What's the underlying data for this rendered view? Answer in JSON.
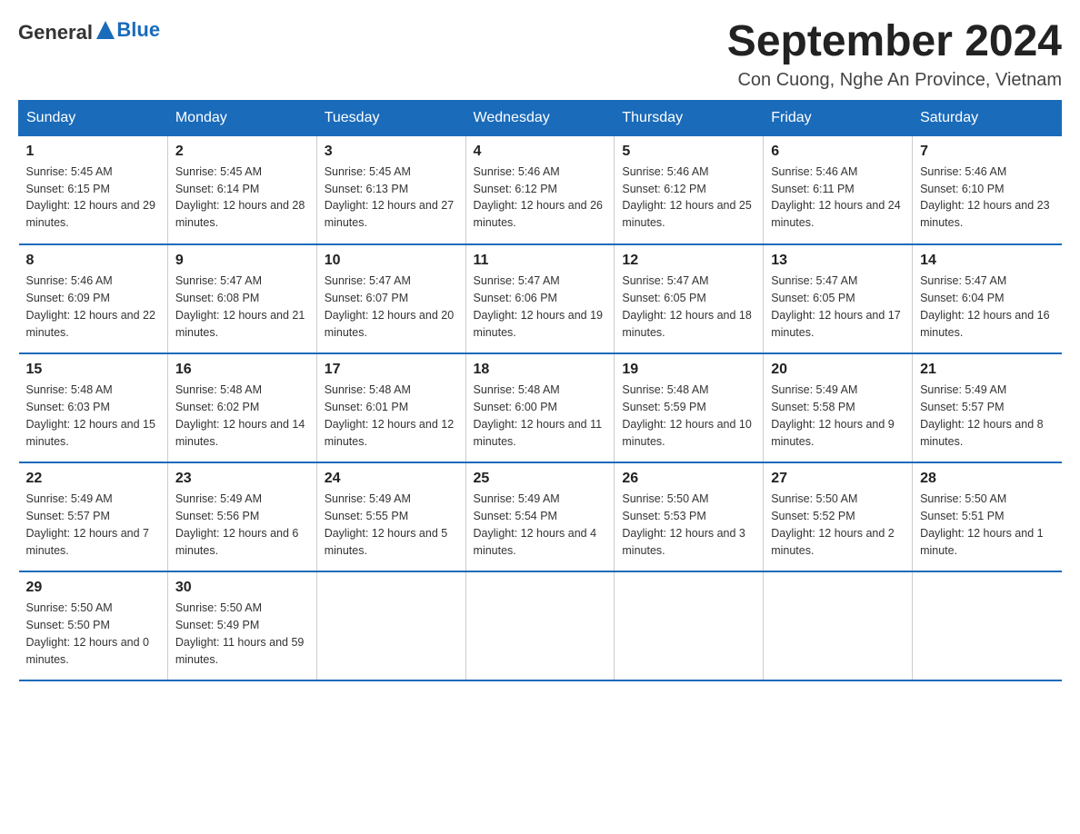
{
  "header": {
    "logo": {
      "general": "General",
      "blue": "Blue"
    },
    "title": "September 2024",
    "subtitle": "Con Cuong, Nghe An Province, Vietnam"
  },
  "columns": [
    "Sunday",
    "Monday",
    "Tuesday",
    "Wednesday",
    "Thursday",
    "Friday",
    "Saturday"
  ],
  "weeks": [
    [
      {
        "day": "1",
        "sunrise": "5:45 AM",
        "sunset": "6:15 PM",
        "daylight": "12 hours and 29 minutes."
      },
      {
        "day": "2",
        "sunrise": "5:45 AM",
        "sunset": "6:14 PM",
        "daylight": "12 hours and 28 minutes."
      },
      {
        "day": "3",
        "sunrise": "5:45 AM",
        "sunset": "6:13 PM",
        "daylight": "12 hours and 27 minutes."
      },
      {
        "day": "4",
        "sunrise": "5:46 AM",
        "sunset": "6:12 PM",
        "daylight": "12 hours and 26 minutes."
      },
      {
        "day": "5",
        "sunrise": "5:46 AM",
        "sunset": "6:12 PM",
        "daylight": "12 hours and 25 minutes."
      },
      {
        "day": "6",
        "sunrise": "5:46 AM",
        "sunset": "6:11 PM",
        "daylight": "12 hours and 24 minutes."
      },
      {
        "day": "7",
        "sunrise": "5:46 AM",
        "sunset": "6:10 PM",
        "daylight": "12 hours and 23 minutes."
      }
    ],
    [
      {
        "day": "8",
        "sunrise": "5:46 AM",
        "sunset": "6:09 PM",
        "daylight": "12 hours and 22 minutes."
      },
      {
        "day": "9",
        "sunrise": "5:47 AM",
        "sunset": "6:08 PM",
        "daylight": "12 hours and 21 minutes."
      },
      {
        "day": "10",
        "sunrise": "5:47 AM",
        "sunset": "6:07 PM",
        "daylight": "12 hours and 20 minutes."
      },
      {
        "day": "11",
        "sunrise": "5:47 AM",
        "sunset": "6:06 PM",
        "daylight": "12 hours and 19 minutes."
      },
      {
        "day": "12",
        "sunrise": "5:47 AM",
        "sunset": "6:05 PM",
        "daylight": "12 hours and 18 minutes."
      },
      {
        "day": "13",
        "sunrise": "5:47 AM",
        "sunset": "6:05 PM",
        "daylight": "12 hours and 17 minutes."
      },
      {
        "day": "14",
        "sunrise": "5:47 AM",
        "sunset": "6:04 PM",
        "daylight": "12 hours and 16 minutes."
      }
    ],
    [
      {
        "day": "15",
        "sunrise": "5:48 AM",
        "sunset": "6:03 PM",
        "daylight": "12 hours and 15 minutes."
      },
      {
        "day": "16",
        "sunrise": "5:48 AM",
        "sunset": "6:02 PM",
        "daylight": "12 hours and 14 minutes."
      },
      {
        "day": "17",
        "sunrise": "5:48 AM",
        "sunset": "6:01 PM",
        "daylight": "12 hours and 12 minutes."
      },
      {
        "day": "18",
        "sunrise": "5:48 AM",
        "sunset": "6:00 PM",
        "daylight": "12 hours and 11 minutes."
      },
      {
        "day": "19",
        "sunrise": "5:48 AM",
        "sunset": "5:59 PM",
        "daylight": "12 hours and 10 minutes."
      },
      {
        "day": "20",
        "sunrise": "5:49 AM",
        "sunset": "5:58 PM",
        "daylight": "12 hours and 9 minutes."
      },
      {
        "day": "21",
        "sunrise": "5:49 AM",
        "sunset": "5:57 PM",
        "daylight": "12 hours and 8 minutes."
      }
    ],
    [
      {
        "day": "22",
        "sunrise": "5:49 AM",
        "sunset": "5:57 PM",
        "daylight": "12 hours and 7 minutes."
      },
      {
        "day": "23",
        "sunrise": "5:49 AM",
        "sunset": "5:56 PM",
        "daylight": "12 hours and 6 minutes."
      },
      {
        "day": "24",
        "sunrise": "5:49 AM",
        "sunset": "5:55 PM",
        "daylight": "12 hours and 5 minutes."
      },
      {
        "day": "25",
        "sunrise": "5:49 AM",
        "sunset": "5:54 PM",
        "daylight": "12 hours and 4 minutes."
      },
      {
        "day": "26",
        "sunrise": "5:50 AM",
        "sunset": "5:53 PM",
        "daylight": "12 hours and 3 minutes."
      },
      {
        "day": "27",
        "sunrise": "5:50 AM",
        "sunset": "5:52 PM",
        "daylight": "12 hours and 2 minutes."
      },
      {
        "day": "28",
        "sunrise": "5:50 AM",
        "sunset": "5:51 PM",
        "daylight": "12 hours and 1 minute."
      }
    ],
    [
      {
        "day": "29",
        "sunrise": "5:50 AM",
        "sunset": "5:50 PM",
        "daylight": "12 hours and 0 minutes."
      },
      {
        "day": "30",
        "sunrise": "5:50 AM",
        "sunset": "5:49 PM",
        "daylight": "11 hours and 59 minutes."
      },
      null,
      null,
      null,
      null,
      null
    ]
  ]
}
